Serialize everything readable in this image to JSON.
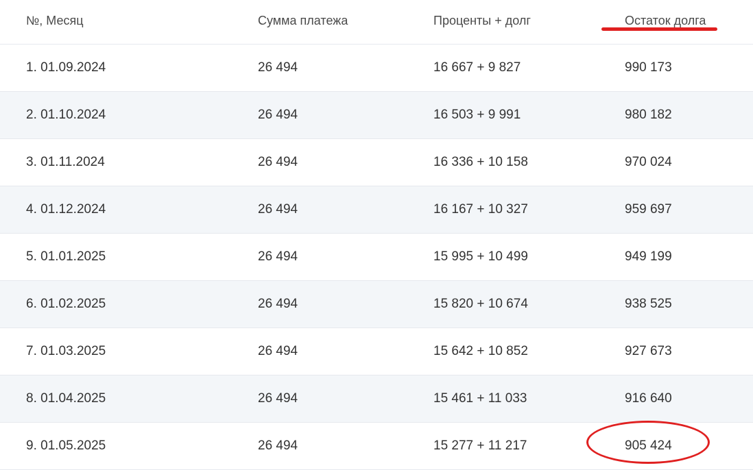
{
  "columns": {
    "num_month": "№, Месяц",
    "payment": "Сумма платежа",
    "interest_principal": "Проценты + долг",
    "balance": "Остаток долга"
  },
  "rows": [
    {
      "month": "1. 01.09.2024",
      "payment": "26 494",
      "split": "16 667 + 9 827",
      "balance": "990 173"
    },
    {
      "month": "2. 01.10.2024",
      "payment": "26 494",
      "split": "16 503 + 9 991",
      "balance": "980 182"
    },
    {
      "month": "3. 01.11.2024",
      "payment": "26 494",
      "split": "16 336 + 10 158",
      "balance": "970 024"
    },
    {
      "month": "4. 01.12.2024",
      "payment": "26 494",
      "split": "16 167 + 10 327",
      "balance": "959 697"
    },
    {
      "month": "5. 01.01.2025",
      "payment": "26 494",
      "split": "15 995 + 10 499",
      "balance": "949 199"
    },
    {
      "month": "6. 01.02.2025",
      "payment": "26 494",
      "split": "15 820 + 10 674",
      "balance": "938 525"
    },
    {
      "month": "7. 01.03.2025",
      "payment": "26 494",
      "split": "15 642 + 10 852",
      "balance": "927 673"
    },
    {
      "month": "8. 01.04.2025",
      "payment": "26 494",
      "split": "15 461 + 11 033",
      "balance": "916 640"
    },
    {
      "month": "9. 01.05.2025",
      "payment": "26 494",
      "split": "15 277 + 11 217",
      "balance": "905 424"
    }
  ],
  "annotations": {
    "color": "#e02020",
    "underline_target": "balance-header",
    "circle_target": "balance-row-9"
  }
}
